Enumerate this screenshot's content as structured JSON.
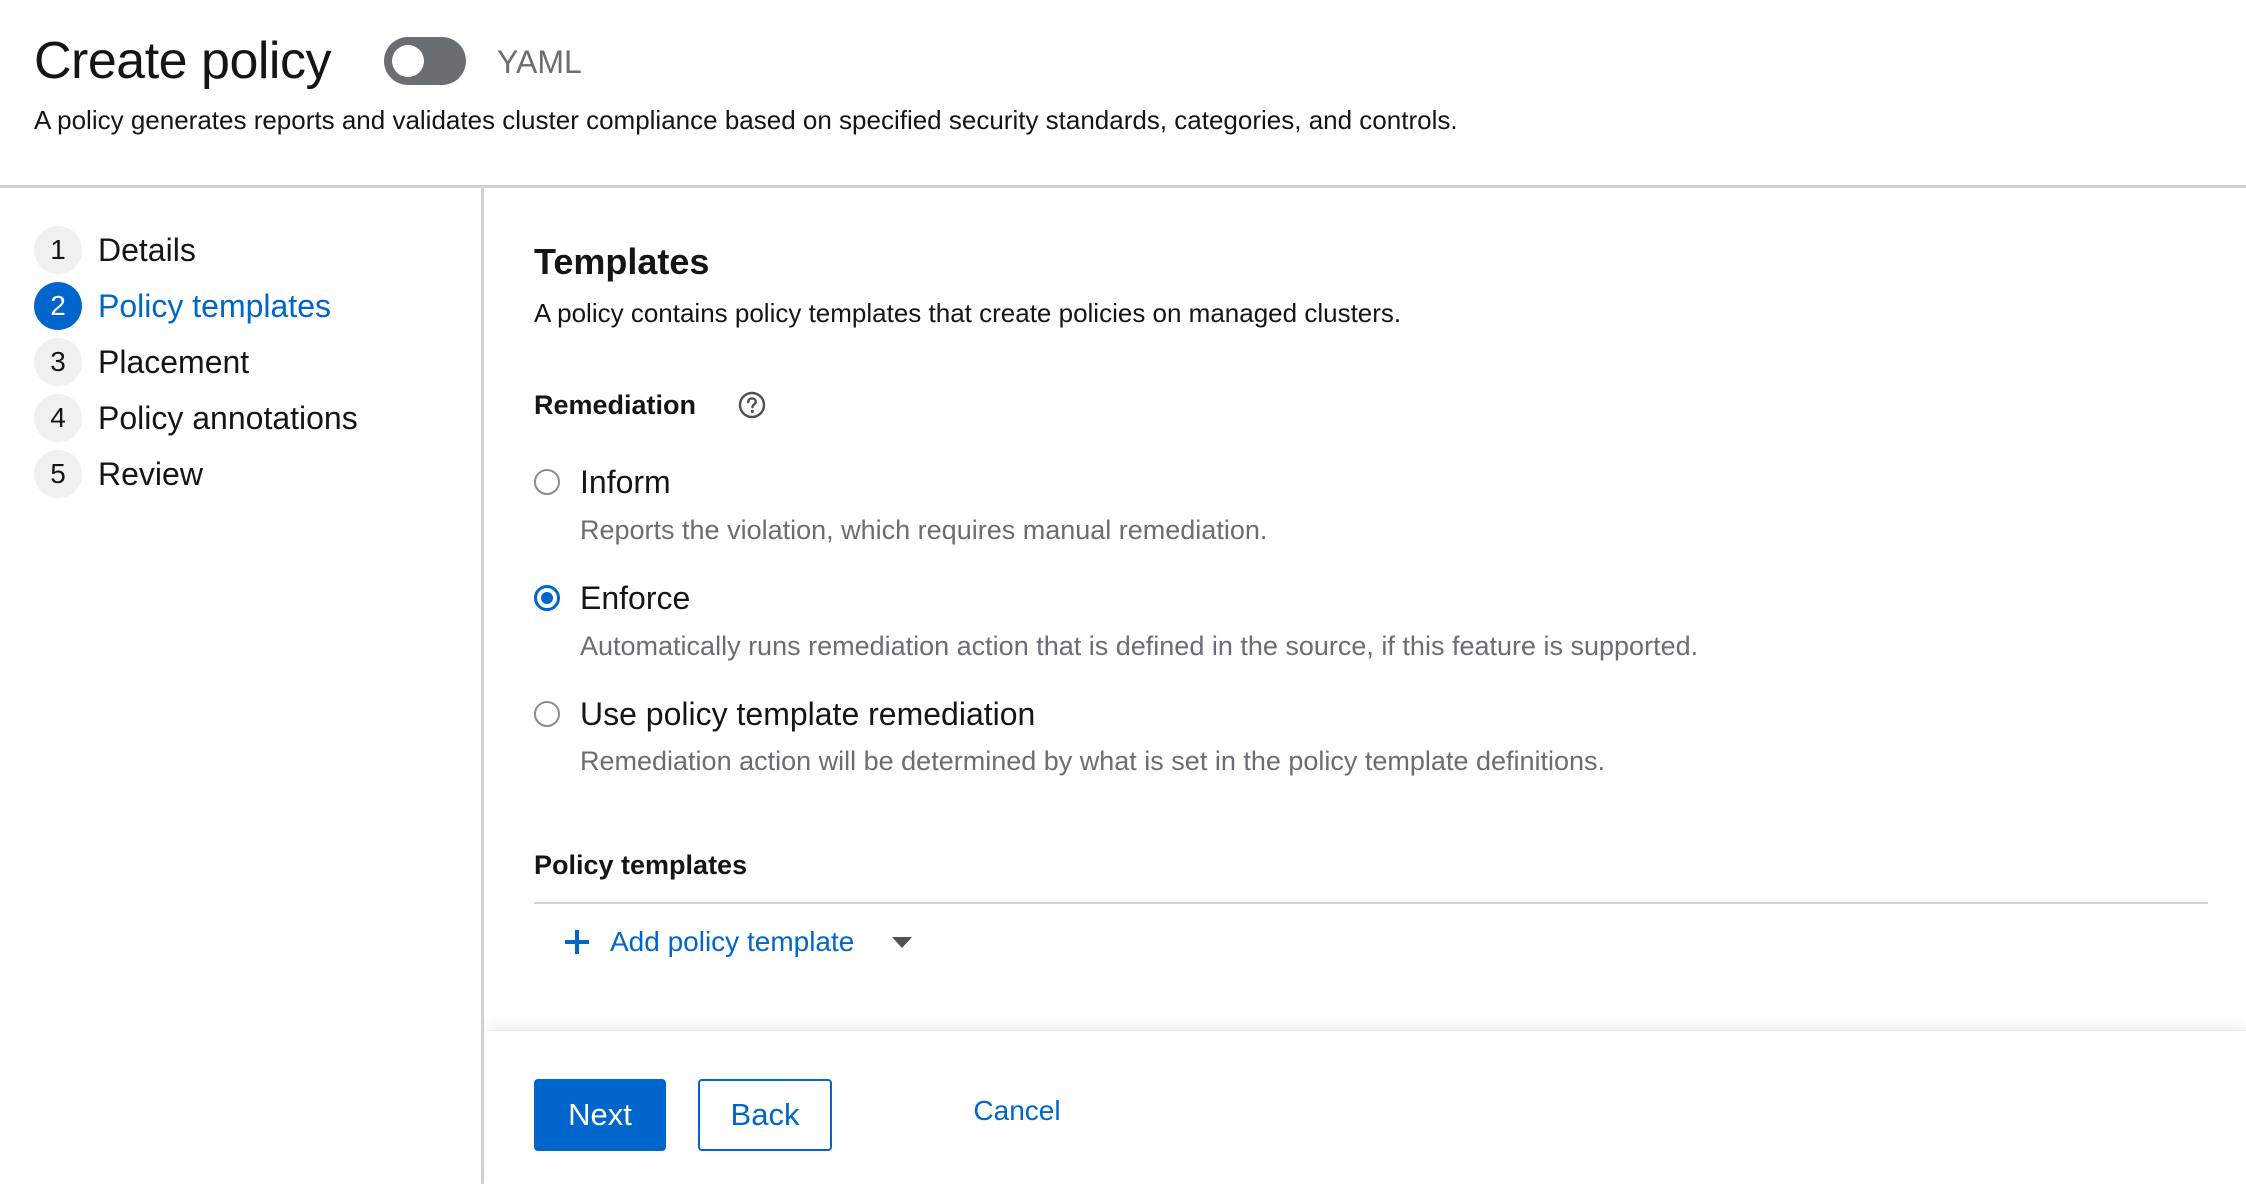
{
  "header": {
    "title": "Create policy",
    "yaml_toggle": {
      "label": "YAML",
      "on": false
    },
    "description": "A policy generates reports and validates cluster compliance based on specified security standards, categories, and controls."
  },
  "wizard_nav": {
    "steps": [
      {
        "number": "1",
        "label": "Details",
        "current": false
      },
      {
        "number": "2",
        "label": "Policy templates",
        "current": true
      },
      {
        "number": "3",
        "label": "Placement",
        "current": false
      },
      {
        "number": "4",
        "label": "Policy annotations",
        "current": false
      },
      {
        "number": "5",
        "label": "Review",
        "current": false
      }
    ]
  },
  "main": {
    "title": "Templates",
    "description": "A policy contains policy templates that create policies on managed clusters.",
    "remediation": {
      "label": "Remediation",
      "help_icon": "question-circle-icon",
      "options": [
        {
          "label": "Inform",
          "description": "Reports the violation, which requires manual remediation.",
          "selected": false
        },
        {
          "label": "Enforce",
          "description": "Automatically runs remediation action that is defined in the source, if this feature is supported.",
          "selected": true
        },
        {
          "label": "Use policy template remediation",
          "description": "Remediation action will be determined by what is set in the policy template definitions.",
          "selected": false
        }
      ]
    },
    "policy_templates": {
      "label": "Policy templates",
      "add_label": "Add policy template"
    }
  },
  "footer": {
    "next_label": "Next",
    "back_label": "Back",
    "cancel_label": "Cancel"
  },
  "colors": {
    "accent": "#0066cc",
    "text": "#151515",
    "muted": "#6a6e73",
    "border": "#d2d2d2"
  }
}
